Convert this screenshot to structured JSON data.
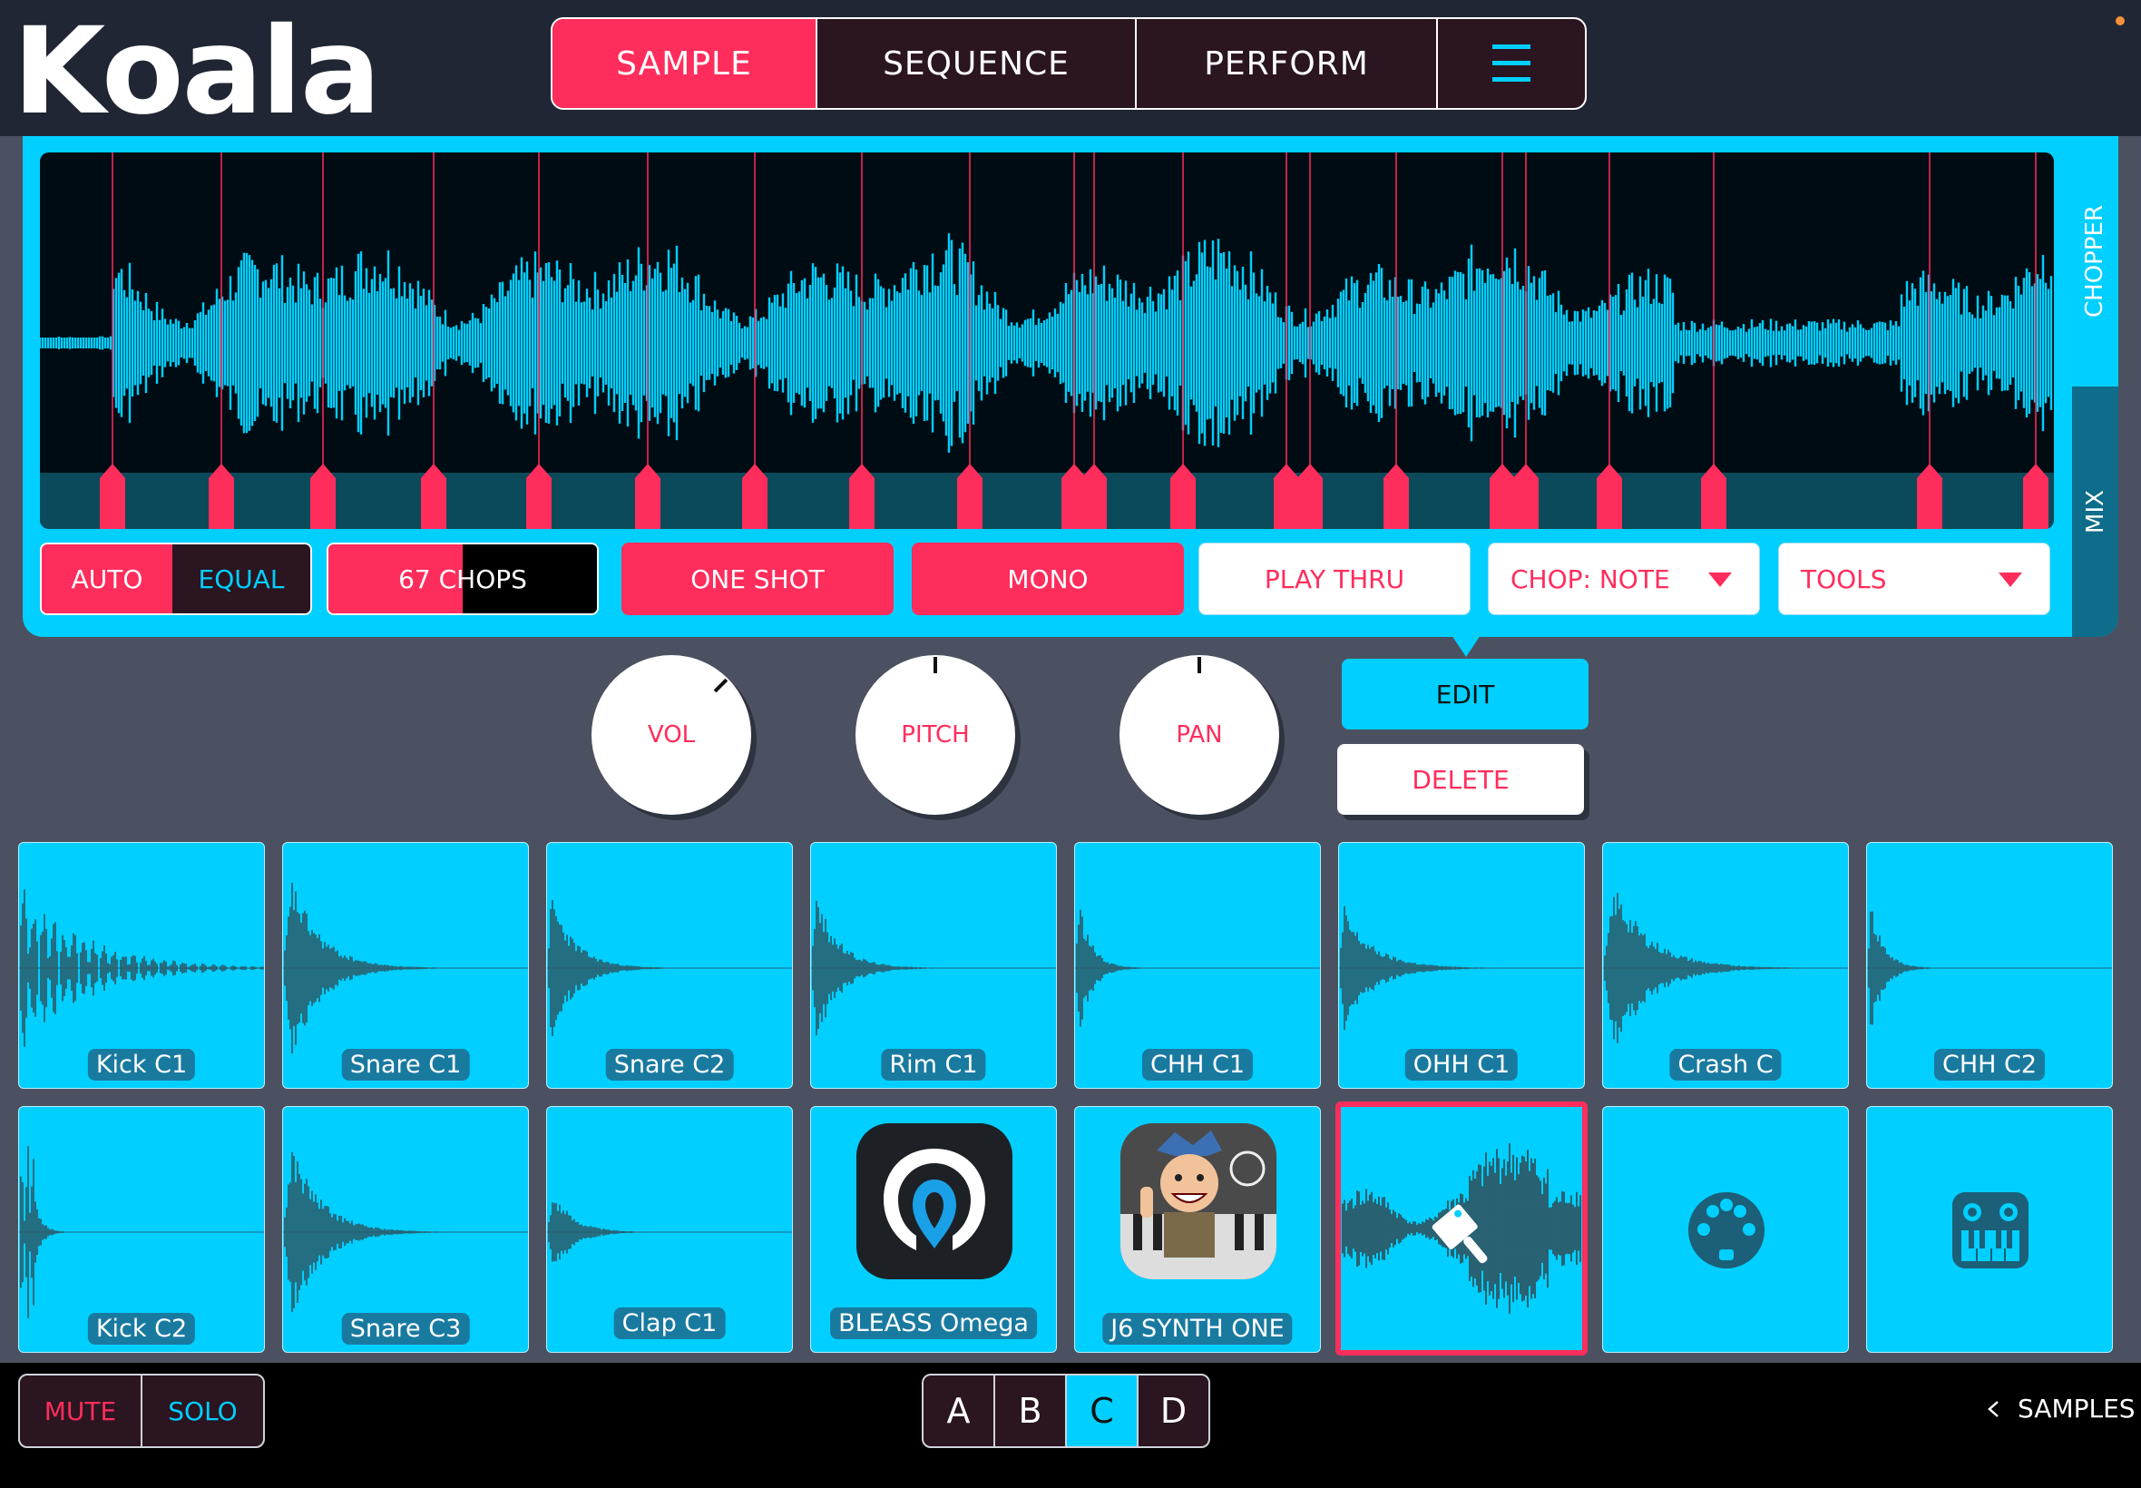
{
  "app": {
    "logo": "Koala"
  },
  "nav": {
    "tabs": [
      {
        "label": "SAMPLE",
        "active": true
      },
      {
        "label": "SEQUENCE",
        "active": false
      },
      {
        "label": "PERFORM",
        "active": false
      }
    ],
    "menu_icon": "hamburger-icon"
  },
  "side_tabs": {
    "chopper": "CHOPPER",
    "mix": "MIX"
  },
  "controls": {
    "auto": "AUTO",
    "equal": "EQUAL",
    "chops": "67 CHOPS",
    "chops_fill_fraction": 0.5,
    "one_shot": "ONE SHOT",
    "mono": "MONO",
    "play_thru": "PLAY THRU",
    "chop_mode": "CHOP: NOTE",
    "tools": "TOOLS"
  },
  "knobs": {
    "vol": "VOL",
    "pitch": "PITCH",
    "pan": "PAN"
  },
  "edit_menu": {
    "edit": "EDIT",
    "delete": "DELETE"
  },
  "pads": [
    {
      "label": "Kick C1",
      "kind": "wave"
    },
    {
      "label": "Snare C1",
      "kind": "wave"
    },
    {
      "label": "Snare C2",
      "kind": "wave"
    },
    {
      "label": "Rim C1",
      "kind": "wave"
    },
    {
      "label": "CHH C1",
      "kind": "wave"
    },
    {
      "label": "OHH C1",
      "kind": "wave"
    },
    {
      "label": "Crash C",
      "kind": "wave"
    },
    {
      "label": "CHH C2",
      "kind": "wave"
    },
    {
      "label": "Kick C2",
      "kind": "wave"
    },
    {
      "label": "Snare C3",
      "kind": "wave"
    },
    {
      "label": "Clap C1",
      "kind": "wave"
    },
    {
      "label": "BLEASS Omega",
      "kind": "app"
    },
    {
      "label": "J6 SYNTH ONE",
      "kind": "app"
    },
    {
      "label": "",
      "kind": "chopper",
      "icon": "cleaver-icon",
      "selected": true
    },
    {
      "label": "",
      "kind": "midi",
      "icon": "midi-icon"
    },
    {
      "label": "",
      "kind": "keyboard",
      "icon": "keyboard-icon"
    }
  ],
  "footer": {
    "mute": "MUTE",
    "solo": "SOLO",
    "banks": [
      "A",
      "B",
      "C",
      "D"
    ],
    "active_bank": "C",
    "samples": "SAMPLES"
  },
  "colors": {
    "accent": "#ff2d5c",
    "cyan": "#00cfff",
    "bg": "#4b5160",
    "header": "#212634"
  }
}
